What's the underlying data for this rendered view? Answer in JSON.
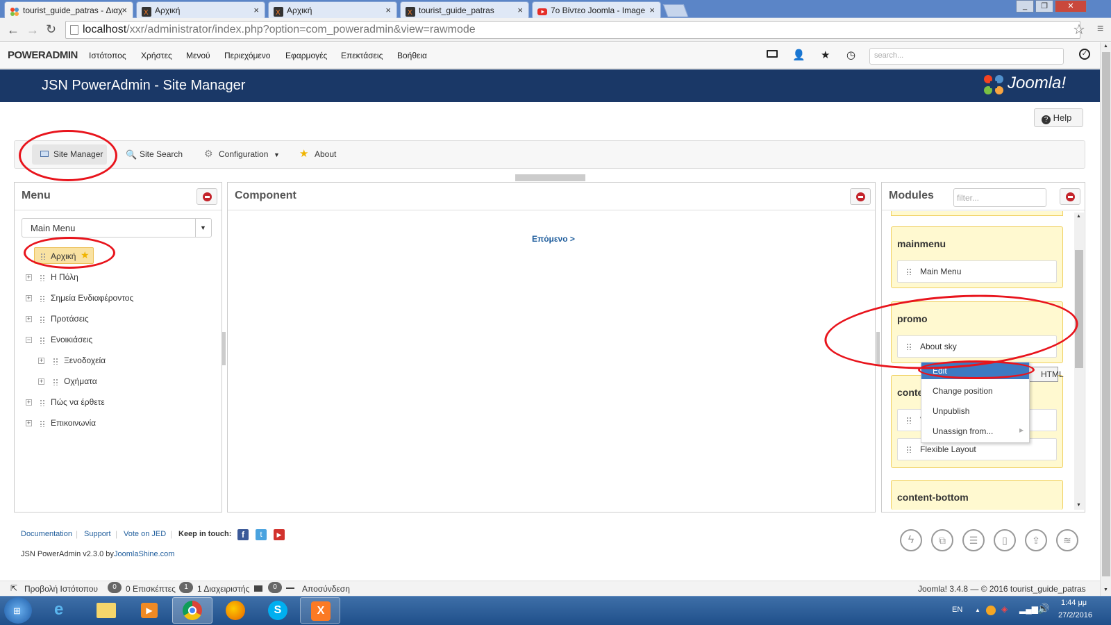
{
  "browser": {
    "tabs": [
      {
        "title": "tourist_guide_patras - Διαχ",
        "icon": "joomla-icon"
      },
      {
        "title": "Αρχική",
        "icon": "xampp-icon"
      },
      {
        "title": "Αρχική",
        "icon": "xampp-icon"
      },
      {
        "title": "tourist_guide_patras",
        "icon": "xampp-icon"
      },
      {
        "title": "7ο Βίντεο Joomla - Image",
        "icon": "youtube-icon"
      }
    ],
    "url_host": "localhost",
    "url_path": "/xxr/administrator/index.php?option=com_poweradmin&view=rawmode"
  },
  "topnav": {
    "logo": "POWERADMIN",
    "items": [
      "Ιστότοπος",
      "Χρήστες",
      "Μενού",
      "Περιεχόμενο",
      "Εφαρμογές",
      "Επεκτάσεις",
      "Βοήθεια"
    ],
    "search_placeholder": "search..."
  },
  "header": {
    "title": "JSN PowerAdmin - Site Manager",
    "brand": "Joomla!"
  },
  "help_label": "Help",
  "toolbar": {
    "site_manager": "Site Manager",
    "site_search": "Site Search",
    "configuration": "Configuration",
    "about": "About"
  },
  "menu_panel": {
    "title": "Menu",
    "select_value": "Main Menu",
    "items": [
      {
        "label": "Αρχική",
        "home": true
      },
      {
        "label": "Η Πόλη"
      },
      {
        "label": "Σημεία Ενδιαφέροντος"
      },
      {
        "label": "Προτάσεις"
      },
      {
        "label": "Ενοικιάσεις"
      },
      {
        "label": "Ξενοδοχεία"
      },
      {
        "label": "Οχήματα"
      },
      {
        "label": "Πώς να έρθετε"
      },
      {
        "label": "Επικοινωνία"
      }
    ]
  },
  "component_panel": {
    "title": "Component",
    "next_link": "Επόμενο >"
  },
  "modules_panel": {
    "title": "Modules",
    "filter_placeholder": "filter...",
    "groups": [
      {
        "name": "mainmenu",
        "modules": [
          "Main Menu"
        ]
      },
      {
        "name": "promo",
        "modules": [
          "About sky"
        ]
      },
      {
        "name": "conte",
        "modules": [
          "V",
          "Flexible Layout"
        ]
      },
      {
        "name": "content-bottom",
        "modules": []
      }
    ],
    "tooltip": "HTML"
  },
  "context_menu": {
    "items": [
      "Edit",
      "Change position",
      "Unpublish",
      "Unassign from..."
    ]
  },
  "footer": {
    "links": [
      "Documentation",
      "Support",
      "Vote on JED"
    ],
    "keep_in_touch": "Keep in touch:",
    "version_prefix": "JSN PowerAdmin v2.3.0 by ",
    "version_link": "JoomlaShine.com"
  },
  "statusbar": {
    "view_site": "Προβολή Ιστότοπου",
    "visitors_count": "0",
    "visitors_label": "0 Επισκέπτες",
    "admins_count": "1",
    "admins_label": "1 Διαχειριστής",
    "messages_count": "0",
    "logout": "Αποσύνδεση",
    "copyright": "Joomla! 3.4.8 — © 2016 tourist_guide_patras"
  },
  "taskbar": {
    "lang": "EN",
    "time": "1:44 μμ",
    "date": "27/2/2016"
  },
  "colors": {
    "header_bg": "#1a3867",
    "accent_red": "#e8141c",
    "module_bg": "#fff9d0",
    "link_blue": "#1f5d9c"
  }
}
